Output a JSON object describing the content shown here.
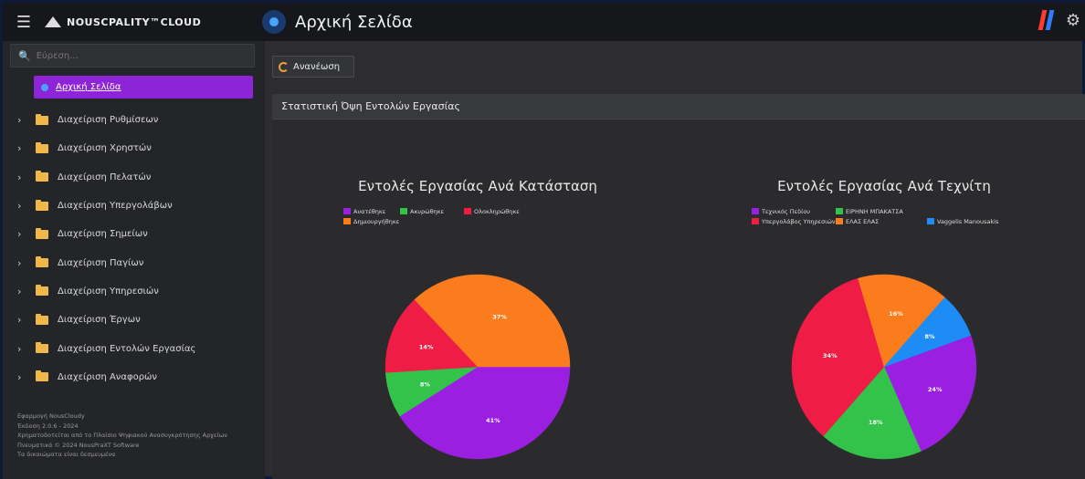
{
  "header": {
    "brand": "NOUSCPALITY™CLOUD",
    "page_title": "Αρχική Σελίδα"
  },
  "sidebar": {
    "search_placeholder": "Εύρεση...",
    "active_item": "Αρχική Σελίδα",
    "items": [
      {
        "label": "Διαχείριση Ρυθμίσεων"
      },
      {
        "label": "Διαχείριση Χρηστών"
      },
      {
        "label": "Διαχείριση Πελατών"
      },
      {
        "label": "Διαχείριση Υπεργολάβων"
      },
      {
        "label": "Διαχείριση Σημείων"
      },
      {
        "label": "Διαχείριση Παγίων"
      },
      {
        "label": "Διαχείριση Υπηρεσιών"
      },
      {
        "label": "Διαχείριση Έργων"
      },
      {
        "label": "Διαχείριση Εντολών Εργασίας"
      },
      {
        "label": "Διαχείριση Αναφορών"
      }
    ],
    "footer": {
      "line1": "Εφαρμογή NousCloudy",
      "line2": "Έκδοση 2.0.6 - 2024",
      "line3": "Χρηματοδοτείται από το Πλαίσιο Ψηφιακού Ανασυγκρότησης Αρχείων",
      "line4": "Πνευματικά © 2024 NousPraXT Software",
      "line5": "Τα δικαιώματα είναι δεσμευμένα"
    }
  },
  "toolbar": {
    "refresh_label": "Ανανέωση"
  },
  "panel": {
    "title": "Στατιστική Όψη Εντολών Εργασίας"
  },
  "chart_data": [
    {
      "type": "pie",
      "title": "Εντολές Εργασίας Ανά Κατάσταση",
      "legend_placement": "top",
      "slices": [
        {
          "label": "Ανατέθηκε",
          "value": 41,
          "color": "#9b1fe0"
        },
        {
          "label": "Ακυρώθηκε",
          "value": 8,
          "color": "#33c24a"
        },
        {
          "label": "Ολοκληρώθηκε",
          "value": 14,
          "color": "#ef1c45"
        },
        {
          "label": "Δημιουργήθηκε",
          "value": 37,
          "color": "#fb7c1c"
        }
      ]
    },
    {
      "type": "pie",
      "title": "Εντολές Εργασίας Ανά Τεχνίτη",
      "legend_placement": "top",
      "slices": [
        {
          "label": "Τεχνικός Πεδίου",
          "value": 24,
          "color": "#9b1fe0"
        },
        {
          "label": "ΕΙΡΗΝΗ ΜΠΑΚΑΤΣΑ",
          "value": 18,
          "color": "#33c24a"
        },
        {
          "label": "Υπεργολάβος Υπηρεσιών",
          "value": 34,
          "color": "#ef1c45"
        },
        {
          "label": "ΕΛΑΣ ΕΛΑΣ",
          "value": 16,
          "color": "#fb7c1c"
        },
        {
          "label": "Vaggelis Manousakis",
          "value": 8,
          "color": "#1e8cf5"
        }
      ]
    }
  ]
}
